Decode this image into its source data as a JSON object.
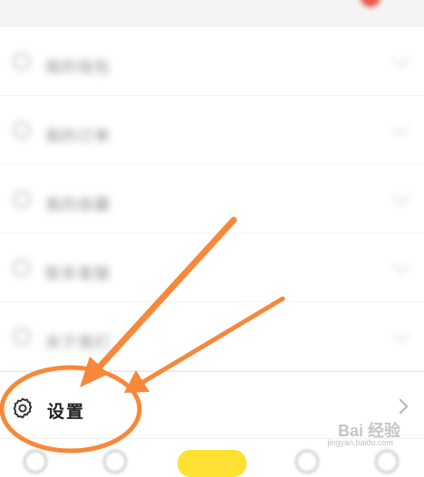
{
  "menu": {
    "blurred_rows": [
      {
        "label": "我的钱包"
      },
      {
        "label": "我的订单"
      },
      {
        "label": "我的收藏"
      },
      {
        "label": "联系客服"
      },
      {
        "label": "关于我们"
      }
    ]
  },
  "settings": {
    "label": "设置",
    "icon": "gear-icon"
  },
  "watermark": {
    "text": "Bai 经验",
    "url": "jingyan.baidu.com"
  },
  "colors": {
    "annotation_orange": "#f7883a",
    "tab_center": "#ffe033",
    "badge_red": "#e8574f"
  }
}
